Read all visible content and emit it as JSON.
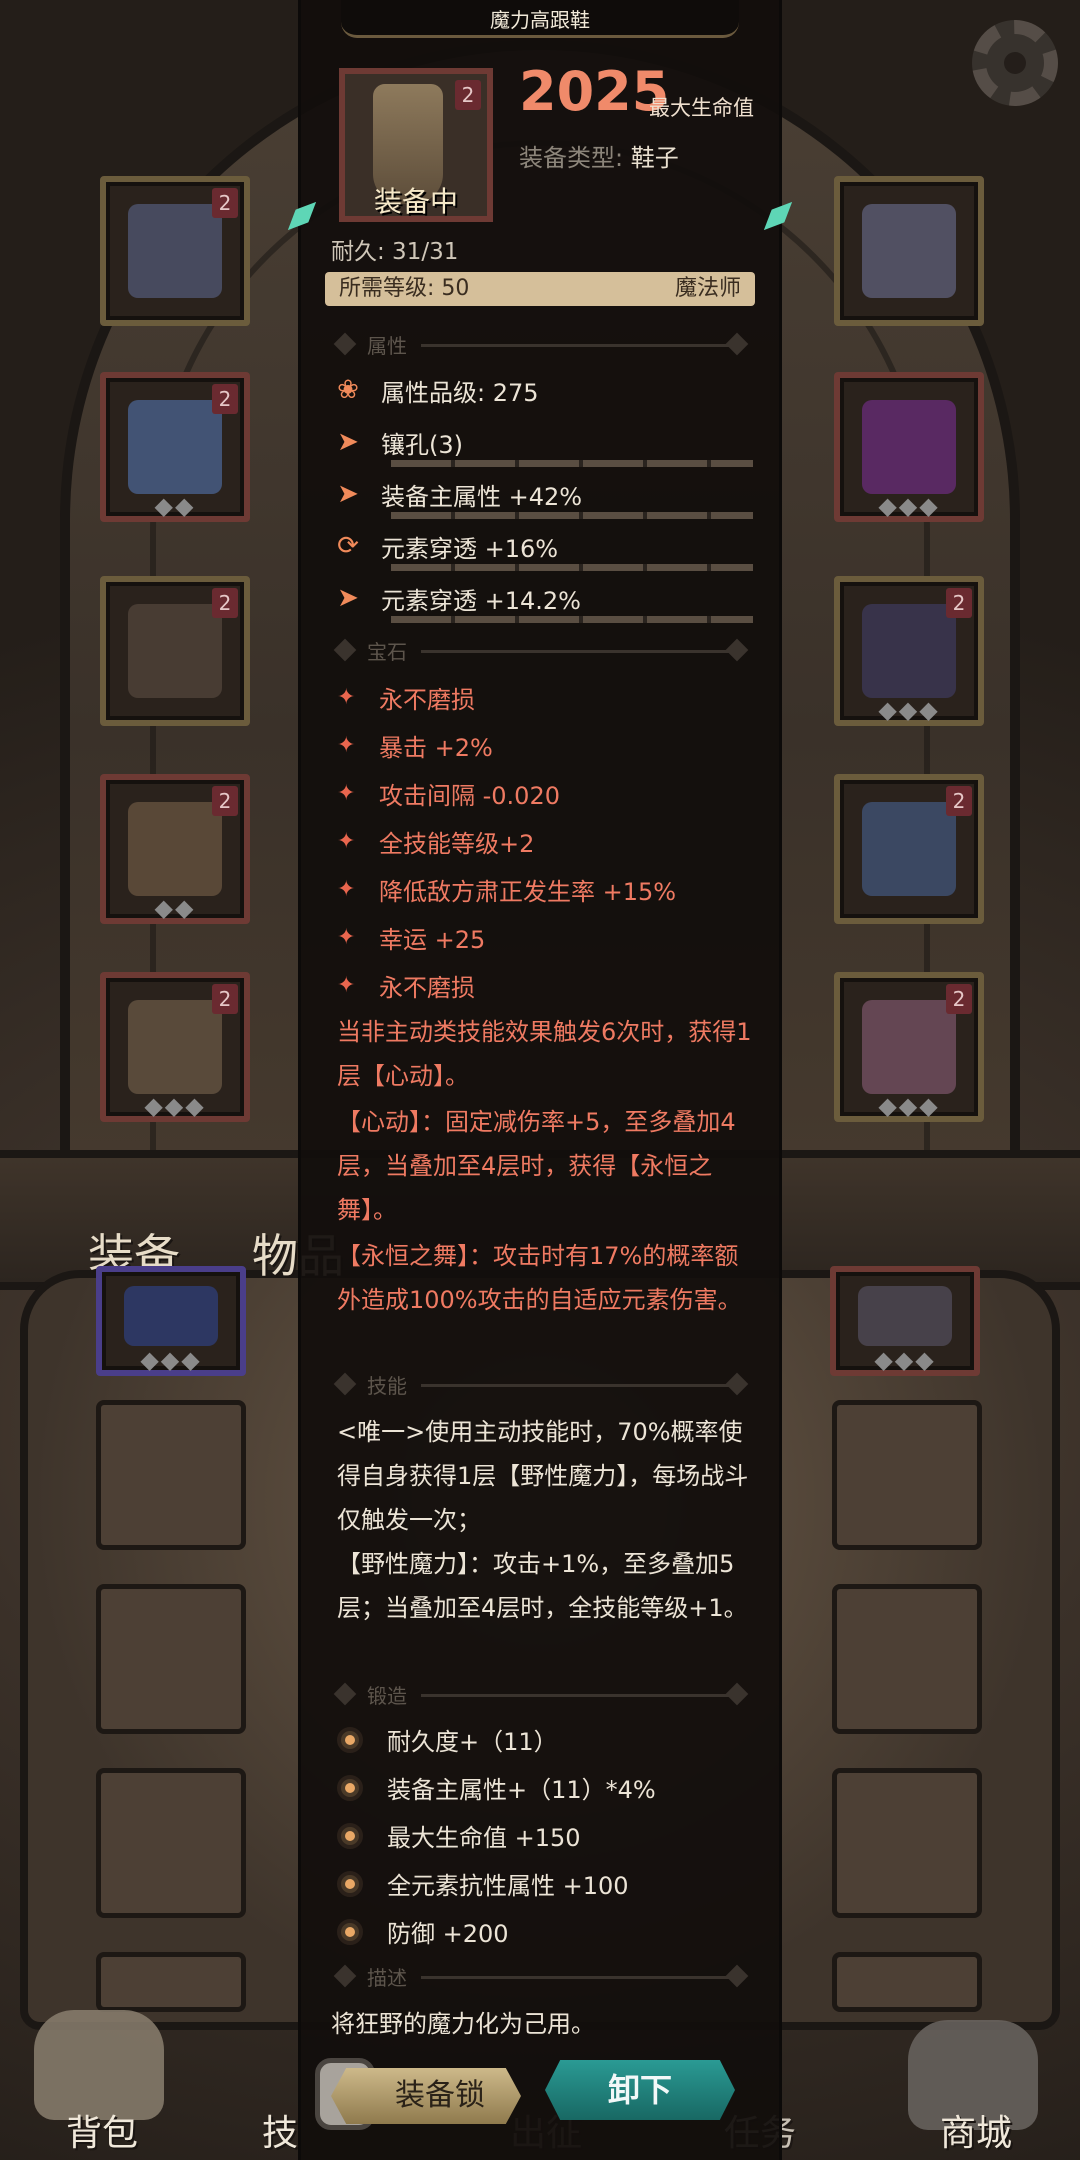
{
  "backdrop": {
    "tab_equipment": "装备",
    "tab_items": "物品",
    "nav": [
      "背包",
      "技",
      "出征",
      "任务",
      "商城"
    ]
  },
  "item": {
    "name": "魔力高跟鞋",
    "level_badge": "2",
    "equipped_label": "装备中",
    "max_hp_value": "2025",
    "max_hp_label": "最大生命值",
    "type_key": "装备类型:",
    "type_value": "鞋子",
    "durability": "耐久: 31/31",
    "required_level": "所需等级: 50",
    "class": "魔法师"
  },
  "sections": {
    "attributes": "属性",
    "gems": "宝石",
    "skills": "技能",
    "forge": "锻造",
    "description": "描述"
  },
  "attributes": [
    {
      "icon": "lotus-icon",
      "text": "属性品级: 275"
    },
    {
      "icon": "arrow-icon",
      "text": "镶孔(3)"
    },
    {
      "icon": "arrow-icon",
      "text": "装备主属性 +42%"
    },
    {
      "icon": "cycle-icon",
      "text": "元素穿透 +16%"
    },
    {
      "icon": "arrow-icon",
      "text": "元素穿透 +14.2%"
    }
  ],
  "gems": [
    "永不磨损",
    "暴击 +2%",
    "攻击间隔 -0.020",
    "全技能等级+2",
    "降低敌方肃正发生率 +15%",
    "幸运 +25",
    "永不磨损"
  ],
  "set_text": [
    "当非主动类技能效果触发6次时，获得1层【心动】。",
    "【心动】：固定减伤率+5，至多叠加4层，当叠加至4层时，获得【永恒之舞】。",
    "【永恒之舞】：攻击时有17%的概率额外造成100%攻击的自适应元素伤害。"
  ],
  "skill_text": [
    "<唯一>使用主动技能时，70%概率使得自身获得1层【野性魔力】，每场战斗仅触发一次；",
    "【野性魔力】：攻击+1%，至多叠加5层；当叠加至4层时，全技能等级+1。"
  ],
  "forge": [
    "耐久度+（11）",
    "装备主属性+（11）*4%",
    "最大生命值 +150",
    "全元素抗性属性 +100",
    "防御 +200"
  ],
  "description_text": "将狂野的魔力化为己用。",
  "buttons": {
    "lock": "装备锁",
    "unequip": "卸下"
  },
  "colors": {
    "accent_red": "#ef7a62",
    "panel_bg": "#120e0c",
    "unequip_teal": "#2a9a94"
  }
}
